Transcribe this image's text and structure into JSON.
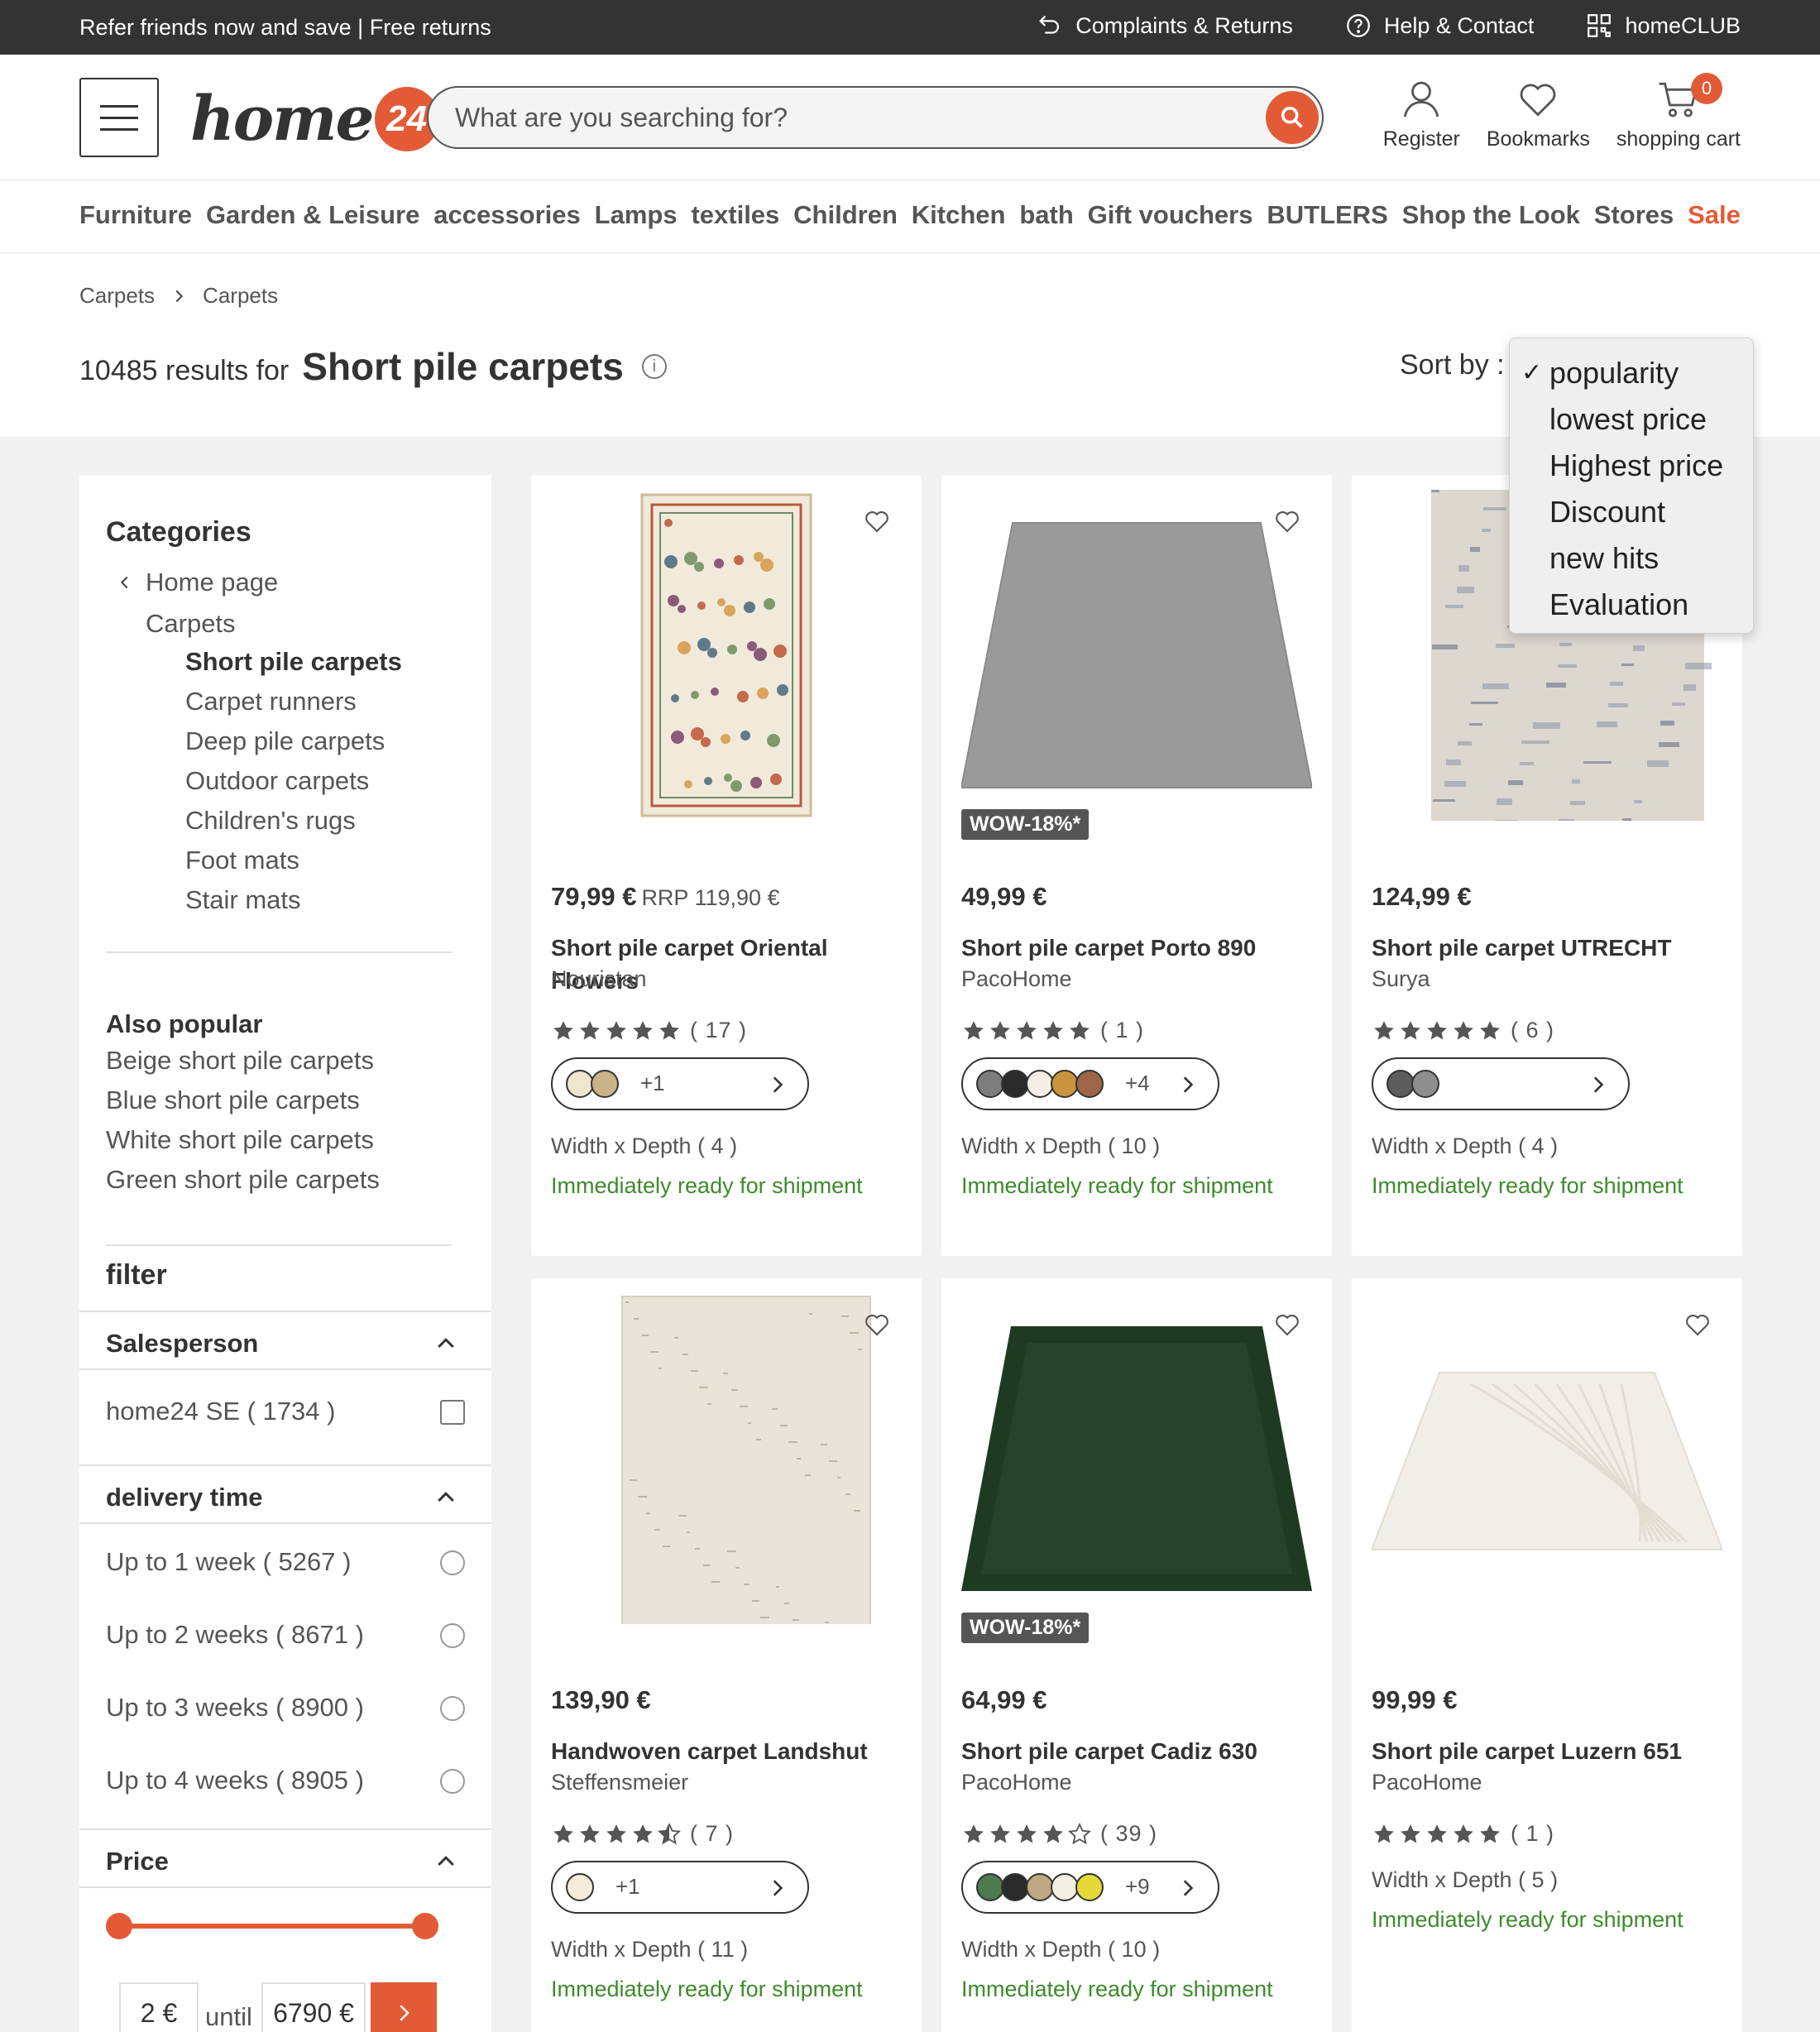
{
  "topbar": {
    "promo": "Refer friends now and save | Free returns",
    "links": [
      {
        "label": "Complaints & Returns",
        "icon": "return-arrow-icon"
      },
      {
        "label": "Help & Contact",
        "icon": "help-circle-icon"
      },
      {
        "label": "homeCLUB",
        "icon": "grid-icon"
      }
    ]
  },
  "header": {
    "logo_text": "home",
    "logo_badge": "24",
    "search_placeholder": "What are you searching for?",
    "register": "Register",
    "bookmarks": "Bookmarks",
    "cart": "shopping cart",
    "cart_count": "0"
  },
  "nav": [
    "Furniture",
    "Garden & Leisure",
    "accessories",
    "Lamps",
    "textiles",
    "Children",
    "Kitchen",
    "bath",
    "Gift vouchers",
    "BUTLERS",
    "Shop the Look",
    "Stores",
    "Sale"
  ],
  "breadcrumb": [
    "Carpets",
    "Carpets"
  ],
  "results": {
    "count_text": "10485 results for",
    "query": "Short pile carpets",
    "info": "i"
  },
  "sort": {
    "label": "Sort by :",
    "check": "✓",
    "options": [
      "popularity",
      "lowest price",
      "Highest price",
      "Discount",
      "new hits",
      "Evaluation"
    ]
  },
  "sidebar": {
    "categories_title": "Categories",
    "back": "Home page",
    "parent": "Carpets",
    "subcategories": [
      "Short pile carpets",
      "Carpet runners",
      "Deep pile carpets",
      "Outdoor carpets",
      "Children's rugs",
      "Foot mats",
      "Stair mats"
    ],
    "popular_title": "Also popular",
    "popular": [
      "Beige short pile carpets",
      "Blue short pile carpets",
      "White short pile carpets",
      "Green short pile carpets"
    ],
    "filter_title": "filter",
    "salesperson_title": "Salesperson",
    "salesperson": {
      "name": "home24 SE",
      "count": "( 1734 )"
    },
    "delivery_title": "delivery time",
    "delivery": [
      {
        "label": "Up to 1 week",
        "count": "( 5267 )"
      },
      {
        "label": "Up to 2 weeks",
        "count": "( 8671 )"
      },
      {
        "label": "Up to 3 weeks",
        "count": "( 8900 )"
      },
      {
        "label": "Up to 4 weeks",
        "count": "( 8905 )"
      }
    ],
    "price_title": "Price",
    "price_min": "2 €",
    "price_until": "until",
    "price_max": "6790 €"
  },
  "products": [
    {
      "price": "79,99 €",
      "rrp": "RRP 119,90 €",
      "name": "Short pile carpet Oriental Flowers",
      "brand": "Nouristan",
      "rating": 5,
      "reviews": "( 17 )",
      "swatches": [
        "#efe6d2",
        "#c9b48a"
      ],
      "more": "+1",
      "dims": "Width x Depth ( 4 )",
      "ship": "Immediately ready for shipment",
      "badge": ""
    },
    {
      "price": "49,99 €",
      "rrp": "",
      "name": "Short pile carpet Porto 890",
      "brand": "PacoHome",
      "rating": 5,
      "reviews": "( 1 )",
      "swatches": [
        "#7d7d7d",
        "#2b2b2b",
        "#f3eee6",
        "#c8953e",
        "#9c6647"
      ],
      "more": "+4",
      "dims": "Width x Depth ( 10 )",
      "ship": "Immediately ready for shipment",
      "badge": "WOW-18%*"
    },
    {
      "price": "124,99 €",
      "rrp": "",
      "name": "Short pile carpet UTRECHT",
      "brand": "Surya",
      "rating": 5,
      "reviews": "( 6 )",
      "swatches": [
        "#5d5d5d",
        "#8e8e8e"
      ],
      "more": "",
      "dims": "Width x Depth ( 4 )",
      "ship": "Immediately ready for shipment",
      "badge": ""
    },
    {
      "price": "139,90 €",
      "rrp": "",
      "name": "Handwoven carpet Landshut",
      "brand": "Steffensmeier",
      "rating": 4.5,
      "reviews": "( 7 )",
      "swatches": [
        "#f4ecd8"
      ],
      "more": "+1",
      "dims": "Width x Depth ( 11 )",
      "ship": "Immediately ready for shipment",
      "badge": ""
    },
    {
      "price": "64,99 €",
      "rrp": "",
      "name": "Short pile carpet Cadiz 630",
      "brand": "PacoHome",
      "rating": 4,
      "reviews": "( 39 )",
      "swatches": [
        "#4d7a4f",
        "#2b2b2b",
        "#bfa982",
        "#f5efe3",
        "#e7d83a"
      ],
      "more": "+9",
      "dims": "Width x Depth ( 10 )",
      "ship": "Immediately ready for shipment",
      "badge": "WOW-18%*"
    },
    {
      "price": "99,99 €",
      "rrp": "",
      "name": "Short pile carpet Luzern 651",
      "brand": "PacoHome",
      "rating": 5,
      "reviews": "( 1 )",
      "swatches": [],
      "more": "",
      "dims": "Width x Depth ( 5 )",
      "ship": "Immediately ready for shipment",
      "badge": ""
    }
  ]
}
